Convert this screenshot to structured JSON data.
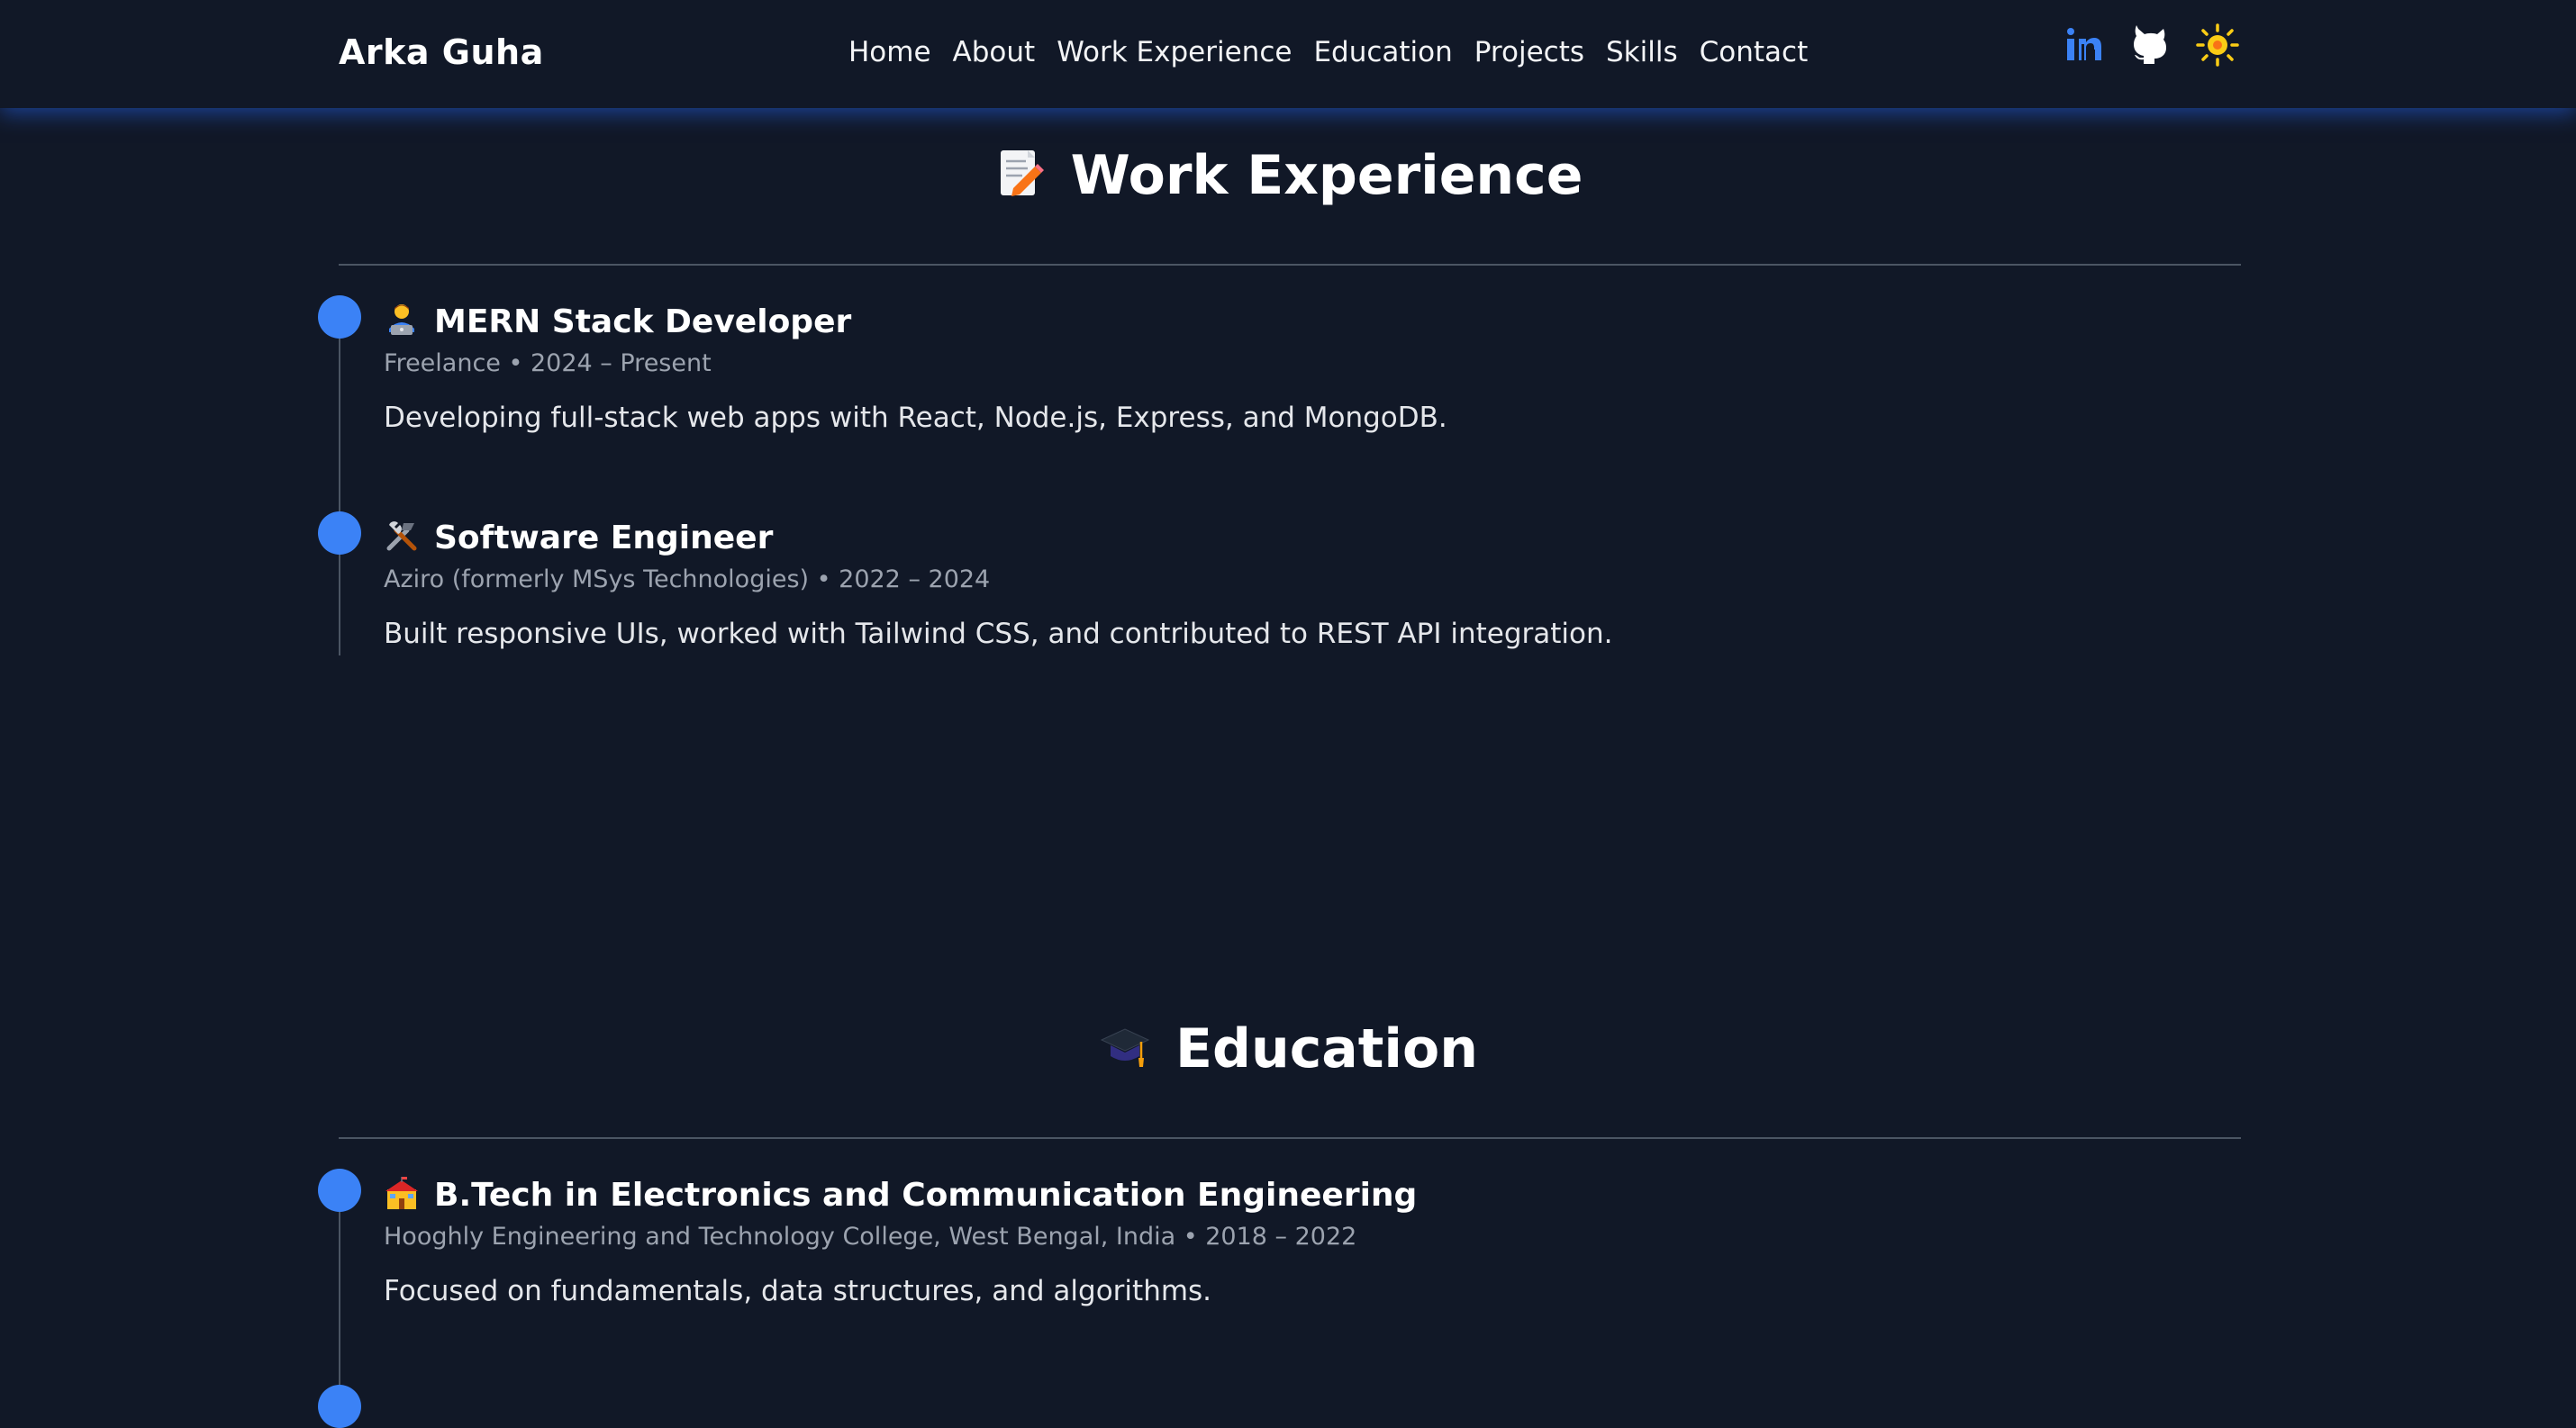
{
  "navbar": {
    "brand": "Arka Guha",
    "links": [
      "Home",
      "About",
      "Work Experience",
      "Education",
      "Projects",
      "Skills",
      "Contact"
    ],
    "icons": [
      "linkedin-icon",
      "github-icon",
      "theme-toggle-sun-icon"
    ]
  },
  "work": {
    "title": "Work Experience",
    "title_icon": "memo-icon",
    "entries": [
      {
        "icon": "technologist-icon",
        "title": "MERN Stack Developer",
        "meta": "Freelance • 2024 – Present",
        "desc": "Developing full-stack web apps with React, Node.js, Express, and MongoDB."
      },
      {
        "icon": "tools-icon",
        "title": "Software Engineer",
        "meta": "Aziro (formerly MSys Technologies) • 2022 – 2024",
        "desc": "Built responsive UIs, worked with Tailwind CSS, and contributed to REST API integration."
      }
    ]
  },
  "education": {
    "title": "Education",
    "title_icon": "graduation-cap-icon",
    "entries": [
      {
        "icon": "school-icon",
        "title": "B.Tech in Electronics and Communication Engineering",
        "meta": "Hooghly Engineering and Technology College, West Bengal, India • 2018 – 2022",
        "desc": "Focused on fundamentals, data structures, and algorithms."
      }
    ]
  },
  "colors": {
    "background": "#111827",
    "accent": "#3b82f6",
    "muted_text": "#9ca3af",
    "divider": "#4b5563"
  }
}
